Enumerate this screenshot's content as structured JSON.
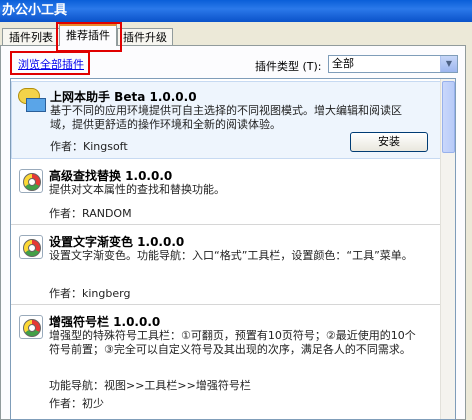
{
  "window": {
    "title": "办公小工具"
  },
  "tabs": [
    {
      "label": "插件列表"
    },
    {
      "label": "推荐插件"
    },
    {
      "label": "插件升级"
    }
  ],
  "toolbar": {
    "browse_all": "浏览全部插件",
    "type_label": "插件类型 (T):",
    "type_value": "全部"
  },
  "plugins": [
    {
      "name": "上网本助手 Beta 1.0.0.0",
      "desc": "基于不同的应用环境提供可自主选择的不同视图模式。增大编辑和阅读区域，提供更舒适的操作环境和全新的阅读体验。",
      "author": "作者：Kingsoft",
      "install": "安装"
    },
    {
      "name": "高级查找替换 1.0.0.0",
      "desc": "提供对文本属性的查找和替换功能。",
      "author": "作者：RANDOM"
    },
    {
      "name": "设置文字渐变色 1.0.0.0",
      "desc": "设置文字渐变色。功能导航：入口“格式”工具栏，设置颜色：“工具”菜单。",
      "author": "作者：kingberg"
    },
    {
      "name": "增强符号栏 1.0.0.0",
      "desc": "增强型的特殊符号工具栏：①可翻页，预置有10页符号；②最近使用的10个符号前置；③完全可以自定义符号及其出现的次序，满足各人的不同需求。",
      "nav": "功能导航：视图>>工具栏>>增强符号栏",
      "author": "作者：初少"
    }
  ]
}
